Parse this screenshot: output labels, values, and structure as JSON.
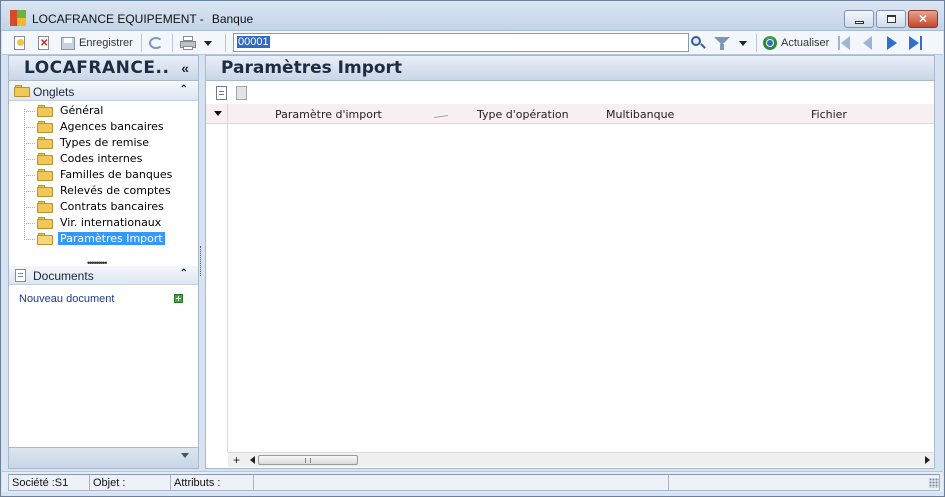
{
  "window": {
    "title": "LOCAFRANCE EQUIPEMENT -",
    "subtitle": "Banque"
  },
  "toolbar": {
    "save_label": "Enregistrer",
    "record_value": "00001",
    "refresh_label": "Actualiser"
  },
  "left_panel": {
    "company": "LOCAFRANCE..",
    "collapse_glyph": "«",
    "tabs_section": "Onglets",
    "tabs": [
      {
        "label": "Général"
      },
      {
        "label": "Agences bancaires"
      },
      {
        "label": "Types de remise"
      },
      {
        "label": "Codes internes"
      },
      {
        "label": "Familles de banques"
      },
      {
        "label": "Relevés de comptes"
      },
      {
        "label": "Contrats bancaires"
      },
      {
        "label": "Vir. internationaux"
      },
      {
        "label": "Paramètres Import",
        "selected": true
      }
    ],
    "documents_section": "Documents",
    "new_document": "Nouveau document"
  },
  "main": {
    "title": "Paramètres Import",
    "columns": [
      {
        "label": "Paramètre d'import"
      },
      {
        "label": "Type d'opération"
      },
      {
        "label": "Multibanque"
      },
      {
        "label": "Fichier"
      }
    ],
    "rows": []
  },
  "statusbar": {
    "societe": "Société :S1",
    "objet": "Objet :",
    "attributs": "Attributs :"
  },
  "colors": {
    "selection": "#3399ff",
    "header_gradient_top": "#e9eff7",
    "header_gradient_bottom": "#cad7e7",
    "grid_header": "#f7eff1"
  }
}
